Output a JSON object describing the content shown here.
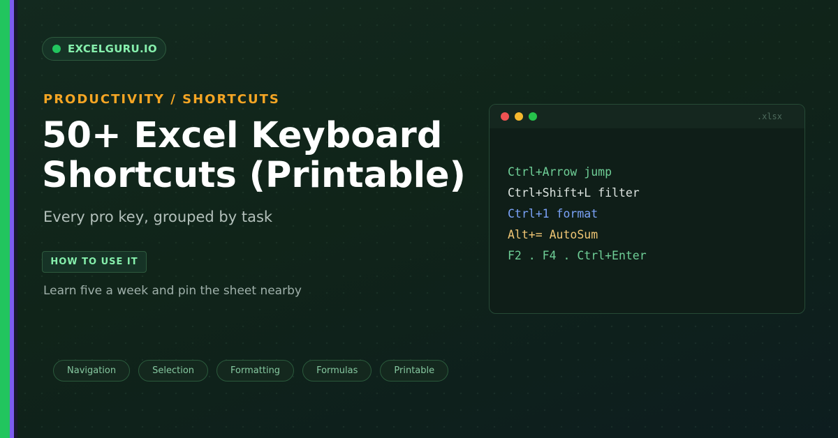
{
  "brand": {
    "name": "EXCELGURU.IO"
  },
  "eyebrow": "PRODUCTIVITY / SHORTCUTS",
  "title": {
    "line1": "50+ Excel Keyboard",
    "line2": "Shortcuts (Printable)"
  },
  "subtitle": "Every pro key, grouped by task",
  "howto": {
    "label": "HOW TO USE IT",
    "text": "Learn five a week and pin the sheet nearby"
  },
  "window": {
    "filetype": ".xlsx",
    "lines": [
      {
        "text": "Ctrl+Arrow jump",
        "color": "#6fcf97"
      },
      {
        "text": "Ctrl+Shift+L filter",
        "color": "#dde4e0"
      },
      {
        "text": "Ctrl+1 format",
        "color": "#7aa2f7"
      },
      {
        "text": "Alt+= AutoSum",
        "color": "#f0c674"
      },
      {
        "text": "F2 . F4 . Ctrl+Enter",
        "color": "#6fcf97"
      }
    ]
  },
  "tags": [
    "Navigation",
    "Selection",
    "Formatting",
    "Formulas",
    "Printable"
  ],
  "colors": {
    "accent_green": "#22c55e",
    "accent_purple": "#7c5cf0",
    "eyebrow_orange": "#f5a524"
  }
}
